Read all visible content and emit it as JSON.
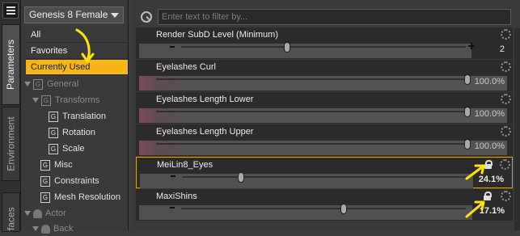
{
  "tabs": {
    "parameters": "Parameters",
    "environment": "Environment",
    "surfaces": "Surfaces"
  },
  "figure_select": {
    "value": "Genesis 8 Female"
  },
  "categories": [
    "All",
    "Favorites",
    "Currently Used"
  ],
  "tree": {
    "general": "General",
    "transforms": "Transforms",
    "translation": "Translation",
    "rotation": "Rotation",
    "scale": "Scale",
    "misc": "Misc",
    "constraints": "Constraints",
    "mesh_resolution": "Mesh Resolution",
    "actor": "Actor",
    "back": "Back",
    "group_glyph": "G"
  },
  "filter": {
    "placeholder": "Enter text to filter by..."
  },
  "properties": [
    {
      "name": "Render SubD Level (Minimum)",
      "value": "2",
      "fraction": 0.38
    },
    {
      "name": "Eyelashes Curl",
      "value": "100.0%",
      "fraction": 1.0
    },
    {
      "name": "Eyelashes Length Lower",
      "value": "100.0%",
      "fraction": 1.0
    },
    {
      "name": "Eyelashes Length Upper",
      "value": "100.0%",
      "fraction": 1.0
    },
    {
      "name": "MeiLin8_Eyes",
      "value": "24.1%",
      "fraction": 0.241,
      "locked": true,
      "highlighted": true
    },
    {
      "name": "MaxiShins",
      "value": "17.1%",
      "fraction": 0.171,
      "locked": true
    }
  ],
  "colors": {
    "accent": "#f5b617",
    "annotation": "#ffe400",
    "panel": "#3a3a3a"
  },
  "icons": [
    "menu-icon",
    "search-icon",
    "gear-icon",
    "lock-icon",
    "group-icon",
    "actor-icon"
  ]
}
